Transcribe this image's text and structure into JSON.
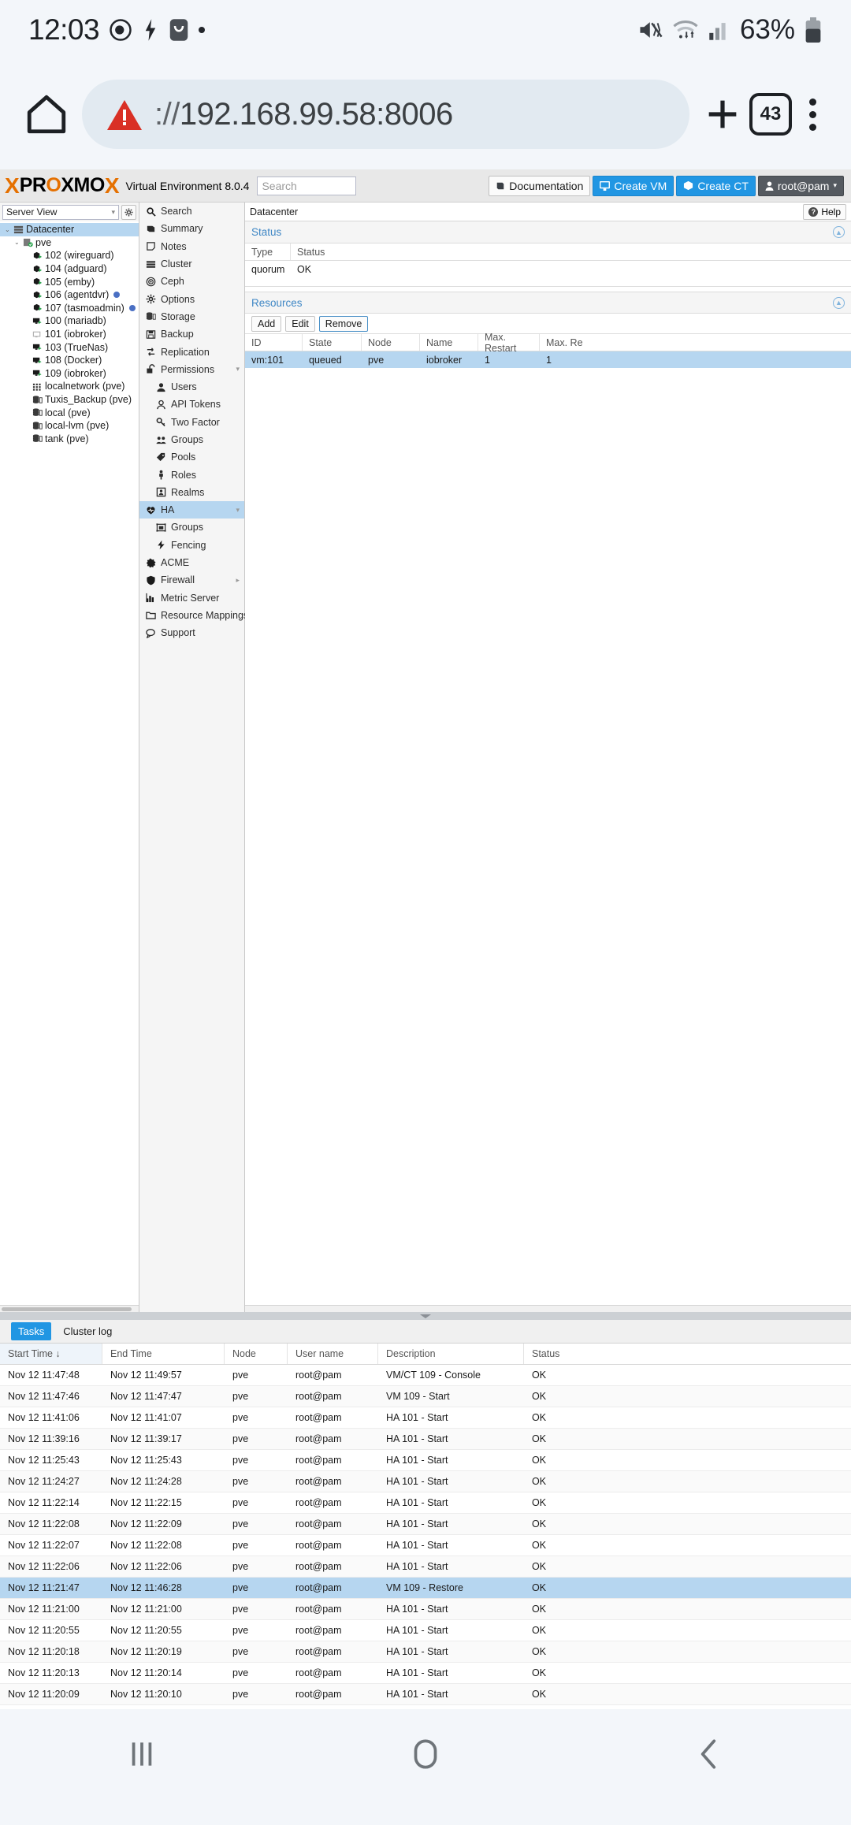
{
  "statusbar": {
    "time": "12:03",
    "battery_pct": "63%",
    "icons": [
      "camera-privacy-icon",
      "flash-icon",
      "app-badge-icon",
      "dot-icon",
      "mute-icon",
      "wifi-icon",
      "signal-icon",
      "battery-icon"
    ]
  },
  "browser": {
    "url_scheme": "://",
    "url": "192.168.99.58:8006",
    "tab_count": "43",
    "home_label": "Home",
    "new_tab_label": "New tab",
    "menu_label": "More options"
  },
  "pve_header": {
    "logo_x": "X",
    "logo_pro": "PR",
    "logo_o": "O",
    "logo_xm": "XMO",
    "logo_x2": "X",
    "product": "Virtual Environment 8.0.4",
    "search_placeholder": "Search",
    "documentation": "Documentation",
    "create_vm": "Create VM",
    "create_ct": "Create CT",
    "user": "root@pam"
  },
  "tree": {
    "view_selector": "Server View",
    "items": [
      {
        "label": "Datacenter",
        "indent": 0,
        "icon": "datacenter-icon",
        "selected": true,
        "arrow": "v",
        "dot": false
      },
      {
        "label": "pve",
        "indent": 1,
        "icon": "node-icon",
        "selected": false,
        "arrow": "v",
        "dot": false
      },
      {
        "label": "102 (wireguard)",
        "indent": 2,
        "icon": "ct-icon",
        "selected": false,
        "arrow": "",
        "dot": false
      },
      {
        "label": "104 (adguard)",
        "indent": 2,
        "icon": "ct-icon",
        "selected": false,
        "arrow": "",
        "dot": false
      },
      {
        "label": "105 (emby)",
        "indent": 2,
        "icon": "ct-icon",
        "selected": false,
        "arrow": "",
        "dot": false
      },
      {
        "label": "106 (agentdvr)",
        "indent": 2,
        "icon": "ct-icon",
        "selected": false,
        "arrow": "",
        "dot": true
      },
      {
        "label": "107 (tasmoadmin)",
        "indent": 2,
        "icon": "ct-icon",
        "selected": false,
        "arrow": "",
        "dot": true
      },
      {
        "label": "100 (mariadb)",
        "indent": 2,
        "icon": "vm-running-icon",
        "selected": false,
        "arrow": "",
        "dot": false
      },
      {
        "label": "101 (iobroker)",
        "indent": 2,
        "icon": "vm-stopped-icon",
        "selected": false,
        "arrow": "",
        "dot": false
      },
      {
        "label": "103 (TrueNas)",
        "indent": 2,
        "icon": "vm-running-icon",
        "selected": false,
        "arrow": "",
        "dot": false
      },
      {
        "label": "108 (Docker)",
        "indent": 2,
        "icon": "vm-running-icon",
        "selected": false,
        "arrow": "",
        "dot": false
      },
      {
        "label": "109 (iobroker)",
        "indent": 2,
        "icon": "vm-running-icon",
        "selected": false,
        "arrow": "",
        "dot": false
      },
      {
        "label": "localnetwork (pve)",
        "indent": 2,
        "icon": "network-icon",
        "selected": false,
        "arrow": "",
        "dot": false
      },
      {
        "label": "Tuxis_Backup (pve)",
        "indent": 2,
        "icon": "storage-icon",
        "selected": false,
        "arrow": "",
        "dot": false
      },
      {
        "label": "local (pve)",
        "indent": 2,
        "icon": "storage-icon",
        "selected": false,
        "arrow": "",
        "dot": false
      },
      {
        "label": "local-lvm (pve)",
        "indent": 2,
        "icon": "storage-icon",
        "selected": false,
        "arrow": "",
        "dot": false
      },
      {
        "label": "tank (pve)",
        "indent": 2,
        "icon": "storage-icon",
        "selected": false,
        "arrow": "",
        "dot": false
      }
    ]
  },
  "nav": {
    "items": [
      {
        "label": "Search",
        "icon": "search-icon",
        "sub": false,
        "selected": false,
        "caret": ""
      },
      {
        "label": "Summary",
        "icon": "summary-icon",
        "sub": false,
        "selected": false,
        "caret": ""
      },
      {
        "label": "Notes",
        "icon": "notes-icon",
        "sub": false,
        "selected": false,
        "caret": ""
      },
      {
        "label": "Cluster",
        "icon": "cluster-icon",
        "sub": false,
        "selected": false,
        "caret": ""
      },
      {
        "label": "Ceph",
        "icon": "ceph-icon",
        "sub": false,
        "selected": false,
        "caret": ""
      },
      {
        "label": "Options",
        "icon": "gear-icon",
        "sub": false,
        "selected": false,
        "caret": ""
      },
      {
        "label": "Storage",
        "icon": "storage-icon",
        "sub": false,
        "selected": false,
        "caret": ""
      },
      {
        "label": "Backup",
        "icon": "backup-icon",
        "sub": false,
        "selected": false,
        "caret": ""
      },
      {
        "label": "Replication",
        "icon": "replication-icon",
        "sub": false,
        "selected": false,
        "caret": ""
      },
      {
        "label": "Permissions",
        "icon": "unlock-icon",
        "sub": false,
        "selected": false,
        "caret": "▾"
      },
      {
        "label": "Users",
        "icon": "user-icon",
        "sub": true,
        "selected": false,
        "caret": ""
      },
      {
        "label": "API Tokens",
        "icon": "token-icon",
        "sub": true,
        "selected": false,
        "caret": ""
      },
      {
        "label": "Two Factor",
        "icon": "key-icon",
        "sub": true,
        "selected": false,
        "caret": ""
      },
      {
        "label": "Groups",
        "icon": "groups-icon",
        "sub": true,
        "selected": false,
        "caret": ""
      },
      {
        "label": "Pools",
        "icon": "tag-icon",
        "sub": true,
        "selected": false,
        "caret": ""
      },
      {
        "label": "Roles",
        "icon": "roles-icon",
        "sub": true,
        "selected": false,
        "caret": ""
      },
      {
        "label": "Realms",
        "icon": "realms-icon",
        "sub": true,
        "selected": false,
        "caret": ""
      },
      {
        "label": "HA",
        "icon": "heart-icon",
        "sub": false,
        "selected": true,
        "caret": "▾"
      },
      {
        "label": "Groups",
        "icon": "ha-groups-icon",
        "sub": true,
        "selected": false,
        "caret": ""
      },
      {
        "label": "Fencing",
        "icon": "fencing-icon",
        "sub": true,
        "selected": false,
        "caret": ""
      },
      {
        "label": "ACME",
        "icon": "acme-icon",
        "sub": false,
        "selected": false,
        "caret": ""
      },
      {
        "label": "Firewall",
        "icon": "shield-icon",
        "sub": false,
        "selected": false,
        "caret": "▸"
      },
      {
        "label": "Metric Server",
        "icon": "chart-icon",
        "sub": false,
        "selected": false,
        "caret": ""
      },
      {
        "label": "Resource Mappings",
        "icon": "folder-icon",
        "sub": false,
        "selected": false,
        "caret": ""
      },
      {
        "label": "Support",
        "icon": "support-icon",
        "sub": false,
        "selected": false,
        "caret": ""
      }
    ]
  },
  "main": {
    "breadcrumb": "Datacenter",
    "help_label": "Help",
    "status_section": {
      "title": "Status",
      "headers": [
        "Type",
        "Status"
      ],
      "rows": [
        [
          "quorum",
          "OK"
        ]
      ]
    },
    "resources_section": {
      "title": "Resources",
      "buttons": [
        "Add",
        "Edit",
        "Remove"
      ],
      "headers": [
        "ID",
        "State",
        "Node",
        "Name",
        "Max. Restart",
        "Max. Re"
      ],
      "rows": [
        [
          "vm:101",
          "queued",
          "pve",
          "iobroker",
          "1",
          "1"
        ]
      ]
    }
  },
  "tasks": {
    "tabs": [
      {
        "label": "Tasks",
        "active": true
      },
      {
        "label": "Cluster log",
        "active": false
      }
    ],
    "headers": [
      "Start Time ↓",
      "End Time",
      "Node",
      "User name",
      "Description",
      "Status"
    ],
    "rows": [
      {
        "start": "Nov 12 11:47:48",
        "end": "Nov 12 11:49:57",
        "node": "pve",
        "user": "root@pam",
        "desc": "VM/CT 109 - Console",
        "status": "OK",
        "highlight": false
      },
      {
        "start": "Nov 12 11:47:46",
        "end": "Nov 12 11:47:47",
        "node": "pve",
        "user": "root@pam",
        "desc": "VM 109 - Start",
        "status": "OK",
        "highlight": false
      },
      {
        "start": "Nov 12 11:41:06",
        "end": "Nov 12 11:41:07",
        "node": "pve",
        "user": "root@pam",
        "desc": "HA 101 - Start",
        "status": "OK",
        "highlight": false
      },
      {
        "start": "Nov 12 11:39:16",
        "end": "Nov 12 11:39:17",
        "node": "pve",
        "user": "root@pam",
        "desc": "HA 101 - Start",
        "status": "OK",
        "highlight": false
      },
      {
        "start": "Nov 12 11:25:43",
        "end": "Nov 12 11:25:43",
        "node": "pve",
        "user": "root@pam",
        "desc": "HA 101 - Start",
        "status": "OK",
        "highlight": false
      },
      {
        "start": "Nov 12 11:24:27",
        "end": "Nov 12 11:24:28",
        "node": "pve",
        "user": "root@pam",
        "desc": "HA 101 - Start",
        "status": "OK",
        "highlight": false
      },
      {
        "start": "Nov 12 11:22:14",
        "end": "Nov 12 11:22:15",
        "node": "pve",
        "user": "root@pam",
        "desc": "HA 101 - Start",
        "status": "OK",
        "highlight": false
      },
      {
        "start": "Nov 12 11:22:08",
        "end": "Nov 12 11:22:09",
        "node": "pve",
        "user": "root@pam",
        "desc": "HA 101 - Start",
        "status": "OK",
        "highlight": false
      },
      {
        "start": "Nov 12 11:22:07",
        "end": "Nov 12 11:22:08",
        "node": "pve",
        "user": "root@pam",
        "desc": "HA 101 - Start",
        "status": "OK",
        "highlight": false
      },
      {
        "start": "Nov 12 11:22:06",
        "end": "Nov 12 11:22:06",
        "node": "pve",
        "user": "root@pam",
        "desc": "HA 101 - Start",
        "status": "OK",
        "highlight": false
      },
      {
        "start": "Nov 12 11:21:47",
        "end": "Nov 12 11:46:28",
        "node": "pve",
        "user": "root@pam",
        "desc": "VM 109 - Restore",
        "status": "OK",
        "highlight": true
      },
      {
        "start": "Nov 12 11:21:00",
        "end": "Nov 12 11:21:00",
        "node": "pve",
        "user": "root@pam",
        "desc": "HA 101 - Start",
        "status": "OK",
        "highlight": false
      },
      {
        "start": "Nov 12 11:20:55",
        "end": "Nov 12 11:20:55",
        "node": "pve",
        "user": "root@pam",
        "desc": "HA 101 - Start",
        "status": "OK",
        "highlight": false
      },
      {
        "start": "Nov 12 11:20:18",
        "end": "Nov 12 11:20:19",
        "node": "pve",
        "user": "root@pam",
        "desc": "HA 101 - Start",
        "status": "OK",
        "highlight": false
      },
      {
        "start": "Nov 12 11:20:13",
        "end": "Nov 12 11:20:14",
        "node": "pve",
        "user": "root@pam",
        "desc": "HA 101 - Start",
        "status": "OK",
        "highlight": false
      },
      {
        "start": "Nov 12 11:20:09",
        "end": "Nov 12 11:20:10",
        "node": "pve",
        "user": "root@pam",
        "desc": "HA 101 - Start",
        "status": "OK",
        "highlight": false
      }
    ]
  },
  "androidnav": {
    "recents": "Recent apps",
    "home": "Home",
    "back": "Back"
  },
  "colors": {
    "accent_blue": "#2196e3",
    "brand_orange": "#e57000",
    "selection_blue": "#b6d6f0",
    "link_blue": "#3f87c5"
  }
}
